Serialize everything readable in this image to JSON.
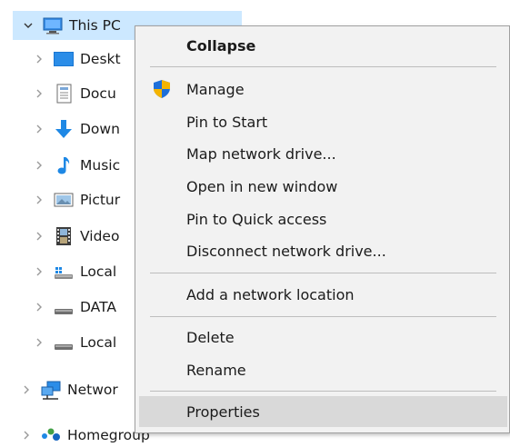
{
  "tree": {
    "this_pc": "This PC",
    "items": [
      {
        "label": "Deskt",
        "icon": "desktop-icon"
      },
      {
        "label": "Docu",
        "icon": "documents-icon"
      },
      {
        "label": "Down",
        "icon": "downloads-icon"
      },
      {
        "label": "Music",
        "icon": "music-icon"
      },
      {
        "label": "Pictur",
        "icon": "pictures-icon"
      },
      {
        "label": "Video",
        "icon": "videos-icon"
      },
      {
        "label": "Local",
        "icon": "local-disk-icon"
      },
      {
        "label": "DATA",
        "icon": "drive-icon"
      },
      {
        "label": "Local",
        "icon": "drive-icon"
      }
    ],
    "network": "Networ",
    "homegroup": "Homegroup"
  },
  "menu": {
    "collapse": "Collapse",
    "manage": "Manage",
    "pin_to_start": "Pin to Start",
    "map_network_drive": "Map network drive...",
    "open_new_window": "Open in new window",
    "pin_quick_access": "Pin to Quick access",
    "disconnect_network_drive": "Disconnect network drive...",
    "add_network_location": "Add a network location",
    "delete": "Delete",
    "rename": "Rename",
    "properties": "Properties"
  },
  "colors": {
    "selection": "#cce8ff",
    "menu_bg": "#f2f2f2",
    "menu_hover": "#d9d9d9",
    "accent_blue": "#1e88e5"
  }
}
